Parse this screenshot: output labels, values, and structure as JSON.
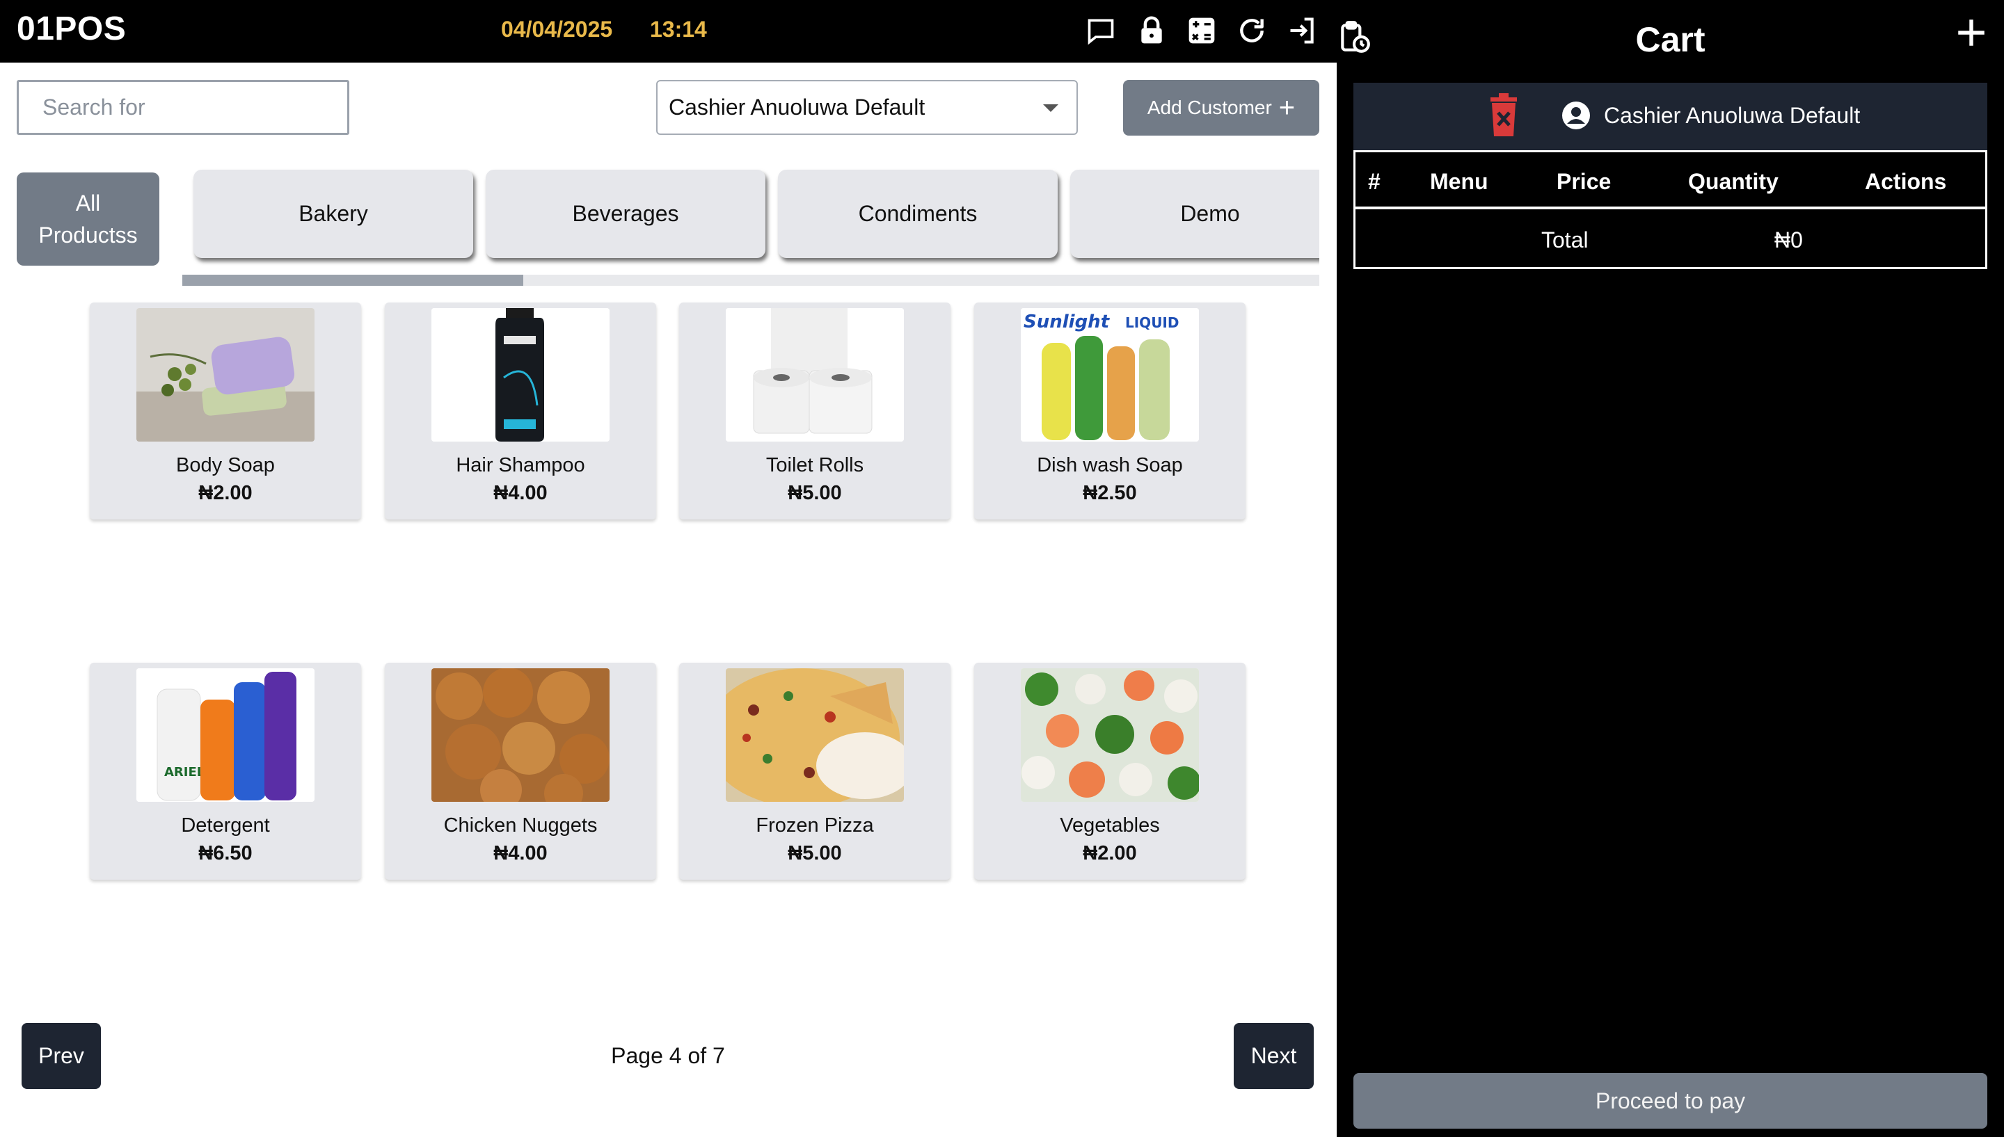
{
  "app": {
    "logo": "01POS",
    "date": "04/04/2025",
    "time": "13:14"
  },
  "topbar_icons": [
    "message-icon",
    "lock-icon",
    "calculator-icon",
    "refresh-icon",
    "logout-icon",
    "clipboard-clock-icon"
  ],
  "search": {
    "placeholder": "Search for",
    "value": ""
  },
  "customer_select": {
    "selected": "Cashier Anuoluwa Default"
  },
  "add_customer": {
    "label": "Add Customer",
    "icon": "+"
  },
  "categories": {
    "all_label": "All Productss",
    "items": [
      "Bakery",
      "Beverages",
      "Condiments",
      "Demo"
    ]
  },
  "products": [
    {
      "name": "Body Soap",
      "price": "₦2.00"
    },
    {
      "name": "Hair Shampoo",
      "price": "₦4.00"
    },
    {
      "name": "Toilet Rolls",
      "price": "₦5.00"
    },
    {
      "name": "Dish wash Soap",
      "price": "₦2.50"
    },
    {
      "name": "Detergent",
      "price": "₦6.50"
    },
    {
      "name": "Chicken Nuggets",
      "price": "₦4.00"
    },
    {
      "name": "Frozen Pizza",
      "price": "₦5.00"
    },
    {
      "name": "Vegetables",
      "price": "₦2.00"
    }
  ],
  "pagination": {
    "prev": "Prev",
    "next": "Next",
    "info": "Page 4 of 7"
  },
  "cart": {
    "title": "Cart",
    "add_icon": "+",
    "customer": "Cashier Anuoluwa Default",
    "columns": [
      "#",
      "Menu",
      "Price",
      "Quantity",
      "Actions"
    ],
    "total_label": "Total",
    "total_value": "₦0",
    "proceed_label": "Proceed to pay"
  },
  "colors": {
    "accent_time": "#e9b94a",
    "button_gray": "#727b87",
    "button_dark": "#1e2532",
    "trash_red": "#d93a3a"
  }
}
